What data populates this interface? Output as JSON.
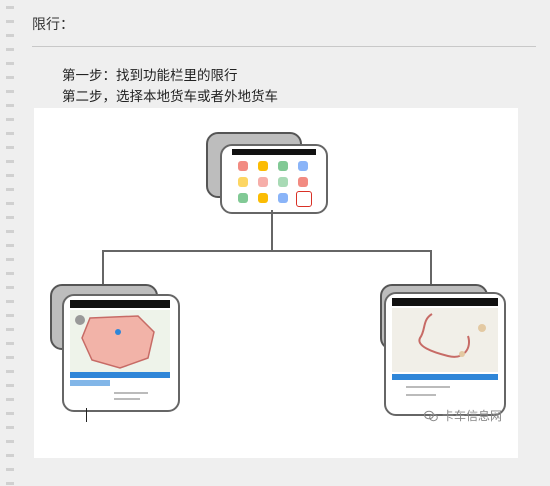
{
  "page": {
    "title": "限行：",
    "steps": [
      "第一步：找到功能栏里的限行",
      "第二步，选择本地货车或者外地货车"
    ]
  },
  "watermark": {
    "text": "卡车信息网",
    "icon": "wechat-logo-icon"
  },
  "colors": {
    "background": "#efefef",
    "panel": "#ffffff",
    "border": "#666666",
    "shadow_card": "#bdbdbd",
    "map_highlight_fill": "#f2b3a8",
    "map_route": "#c76b66",
    "blue_strip": "#2f86d8"
  },
  "diagram": {
    "nodes": [
      "app-function-menu",
      "local-truck-restriction-map",
      "outside-truck-restriction-map"
    ]
  }
}
